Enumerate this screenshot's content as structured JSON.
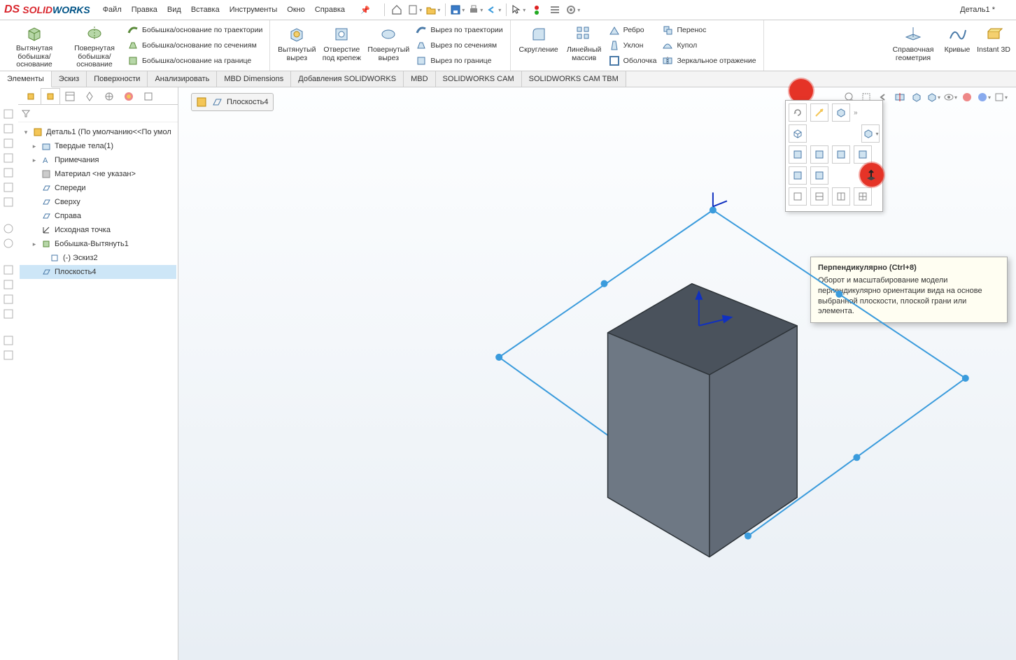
{
  "app": {
    "brand_ds": "DS",
    "brand1": "SOLID",
    "brand2": "WORKS",
    "doc": "Деталь1 *"
  },
  "menu": [
    "Файл",
    "Правка",
    "Вид",
    "Вставка",
    "Инструменты",
    "Окно",
    "Справка"
  ],
  "ribbon": {
    "extrude": "Вытянутая бобышка/основание",
    "revolve": "Повернутая бобышка/основание",
    "sweep": "Бобышка/основание по траектории",
    "loft": "Бобышка/основание по сечениям",
    "boundary": "Бобышка/основание на границе",
    "cut_ext": "Вытянутый вырез",
    "hole": "Отверстие под крепеж",
    "cut_rev": "Повернутый вырез",
    "cut_sweep": "Вырез по траектории",
    "cut_loft": "Вырез по сечениям",
    "cut_boundary": "Вырез по границе",
    "fillet": "Скругление",
    "pattern": "Линейный массив",
    "rib": "Ребро",
    "draft": "Уклон",
    "shell": "Оболочка",
    "move": "Перенос",
    "dome": "Купол",
    "mirror": "Зеркальное отражение",
    "refgeom": "Справочная геометрия",
    "curves": "Кривые",
    "instant": "Instant 3D"
  },
  "tabs": [
    "Элементы",
    "Эскиз",
    "Поверхности",
    "Анализировать",
    "MBD Dimensions",
    "Добавления SOLIDWORKS",
    "MBD",
    "SOLIDWORKS CAM",
    "SOLIDWORKS CAM TBM"
  ],
  "tree": {
    "root": "Деталь1  (По умолчанию<<По умол",
    "solid": "Твердые тела(1)",
    "notes": "Примечания",
    "material": "Материал <не указан>",
    "front": "Спереди",
    "top": "Сверху",
    "right": "Справа",
    "origin": "Исходная точка",
    "feat": "Бобышка-Вытянуть1",
    "sketch": "(-) Эскиз2",
    "plane": "Плоскость4"
  },
  "breadcrumb": "Плоскость4",
  "tooltip": {
    "title": "Перпендикулярно   (Ctrl+8)",
    "body": "Оборот и масштабирование модели перпендикулярно ориентации вида на основе выбранной плоскости, плоской грани или элемента."
  }
}
